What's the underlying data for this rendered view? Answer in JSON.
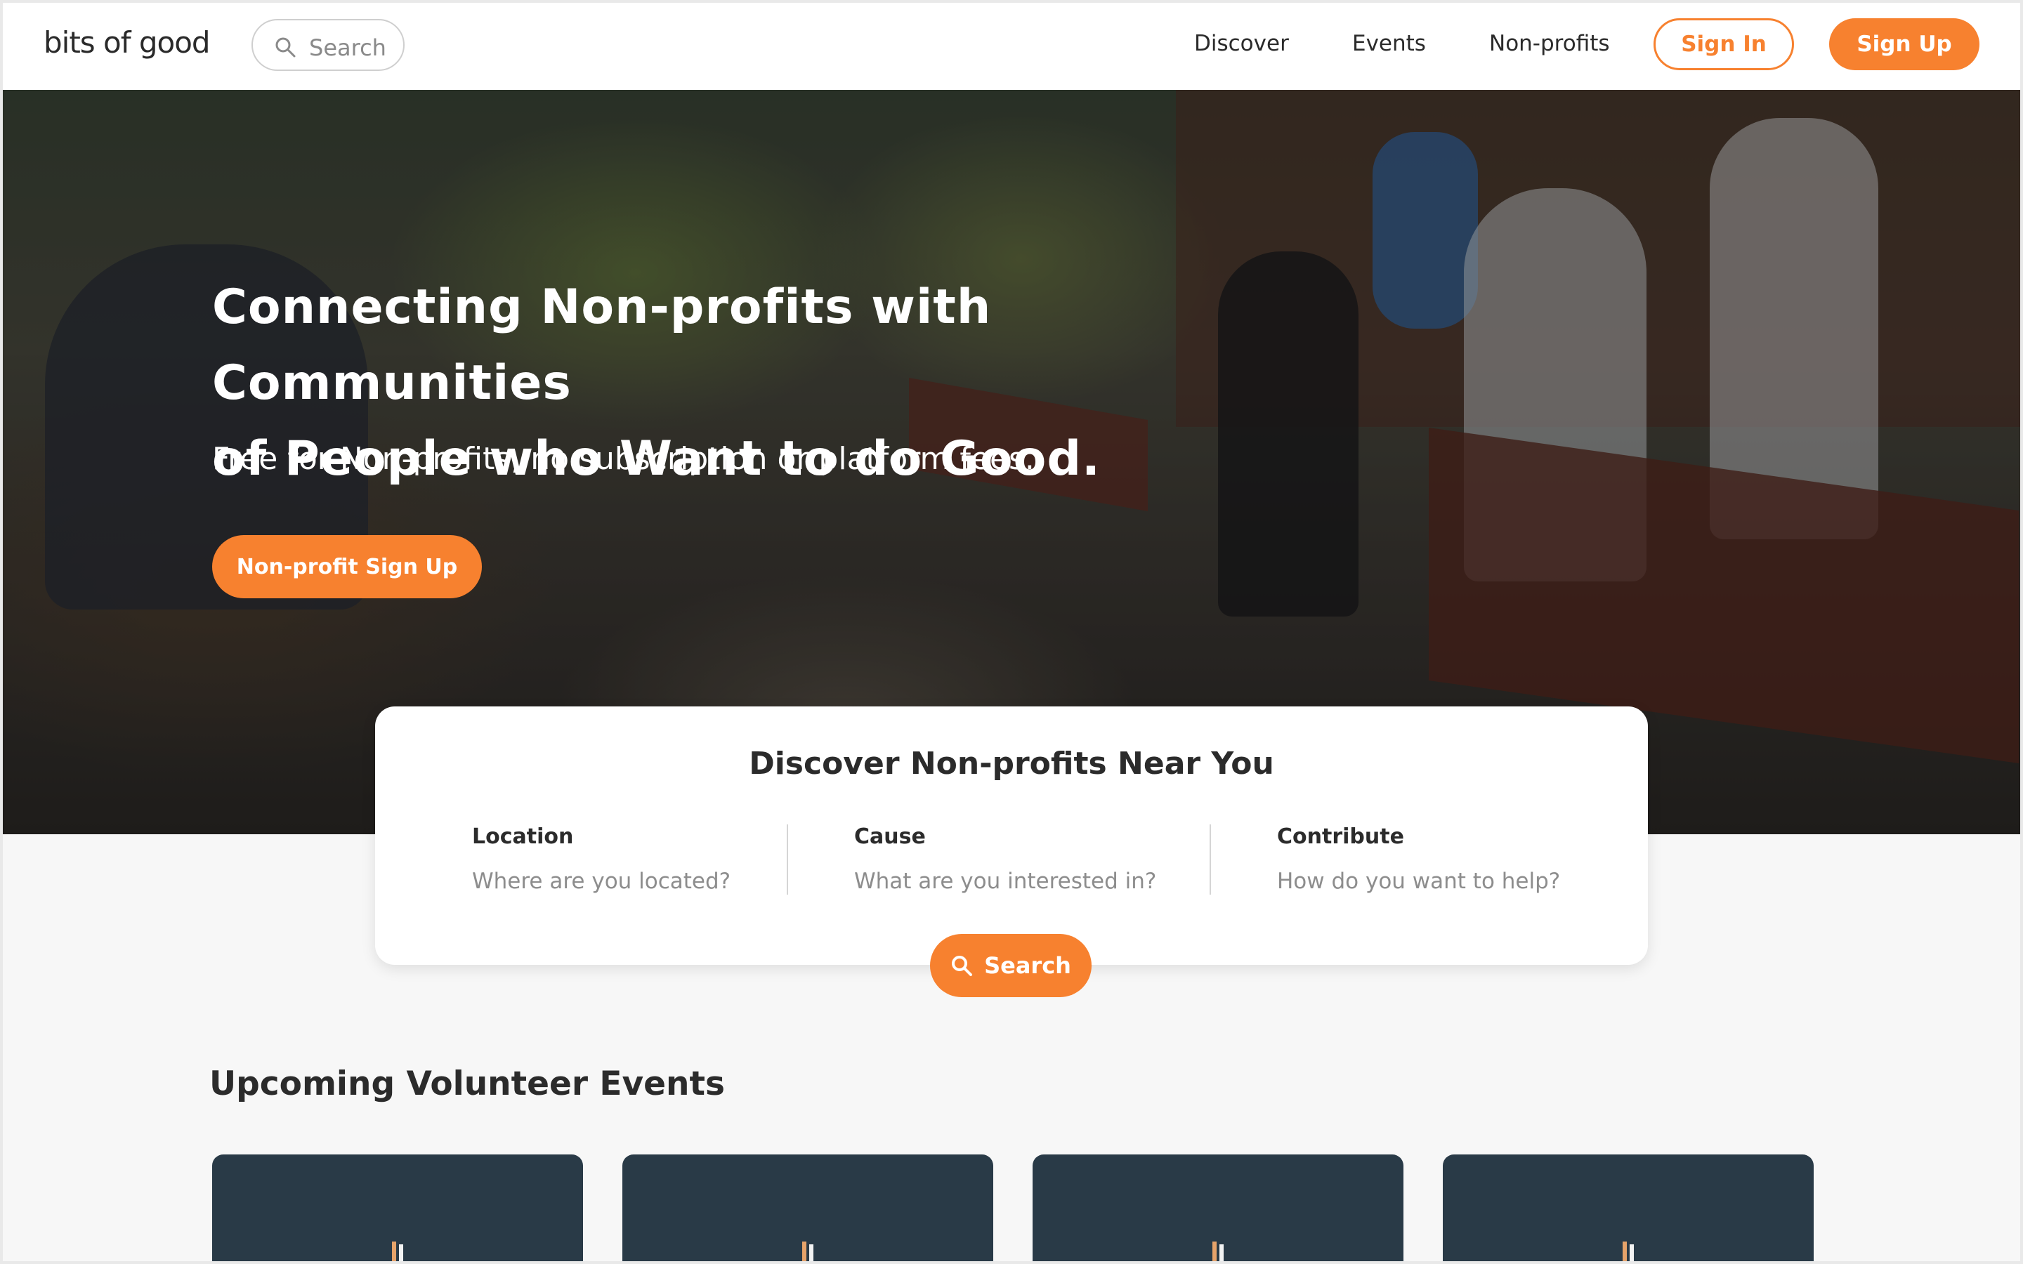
{
  "header": {
    "logo": "bits of good",
    "search_placeholder": "Search",
    "nav": [
      "Discover",
      "Events",
      "Non-profits"
    ],
    "sign_in": "Sign In",
    "sign_up": "Sign Up"
  },
  "hero": {
    "title_line1": "Connecting Non-profits with Communities",
    "title_line2": "of People who Want to do Good.",
    "subtitle": "Free for Non-profits, no subscription or platform fees.",
    "cta": "Non-profit Sign Up"
  },
  "discover": {
    "title": "Discover Non-profits Near You",
    "fields": [
      {
        "label": "Location",
        "placeholder": "Where are you located?"
      },
      {
        "label": "Cause",
        "placeholder": "What are you interested in?"
      },
      {
        "label": "Contribute",
        "placeholder": "How do you want to help?"
      }
    ],
    "search_button": "Search"
  },
  "events": {
    "title": "Upcoming Volunteer Events",
    "cards": [
      {
        "icon": "candle-icon"
      },
      {
        "icon": "candle-icon"
      },
      {
        "icon": "candle-icon"
      },
      {
        "icon": "candle-icon"
      }
    ]
  },
  "colors": {
    "accent": "#f7812f",
    "card_dark": "#293a47"
  }
}
